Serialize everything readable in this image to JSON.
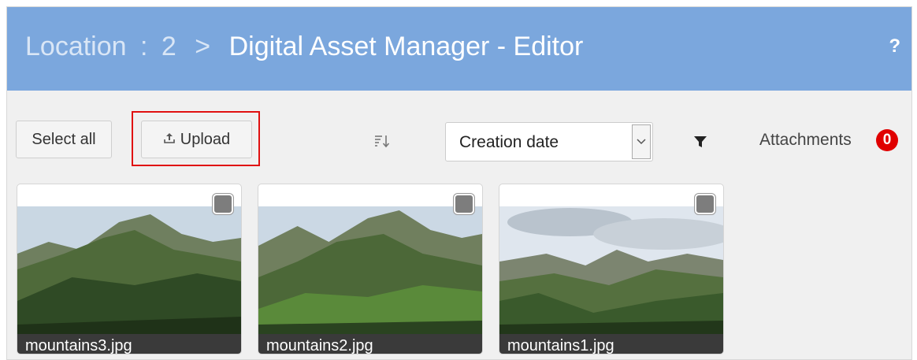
{
  "header": {
    "location_label": "Location",
    "separator": ":",
    "location_id": "2",
    "chevron": ">",
    "title": "Digital Asset Manager - Editor",
    "help": "?"
  },
  "toolbar": {
    "select_all": "Select all",
    "upload": "Upload",
    "upload_icon": "upload-icon",
    "sort_icon": "sort-icon",
    "sort_value": "Creation date",
    "filter_icon": "filter-icon",
    "attachments_label": "Attachments",
    "attachments_count": "0"
  },
  "assets": [
    {
      "name": "mountains3.jpg"
    },
    {
      "name": "mountains2.jpg"
    },
    {
      "name": "mountains1.jpg"
    }
  ],
  "colors": {
    "header": "#7ba7dd",
    "highlight": "#e01010",
    "badge": "#e00000"
  }
}
